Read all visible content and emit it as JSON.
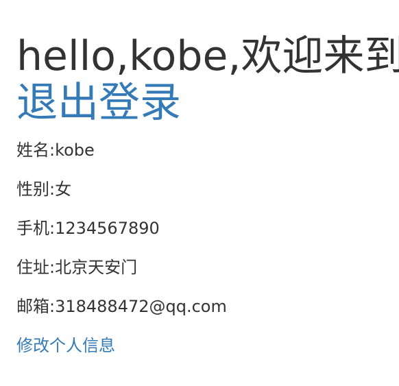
{
  "greeting": "hello,kobe,欢迎来到",
  "logout_label": "退出登录",
  "profile": {
    "name": "姓名:kobe",
    "gender": "性别:女",
    "phone": "手机:1234567890",
    "address": "住址:北京天安门",
    "email": "邮箱:318488472@qq.com"
  },
  "edit_link_label": "修改个人信息",
  "colors": {
    "text": "#333333",
    "link": "#337ab7"
  }
}
